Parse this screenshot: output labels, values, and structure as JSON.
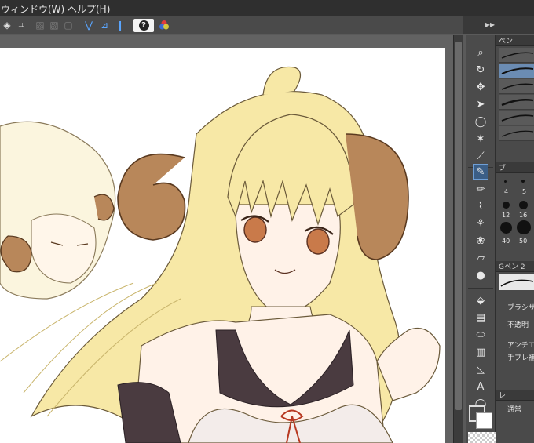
{
  "menu": {
    "window_label": "ウィンドウ(W)",
    "help_label": "ヘルプ(H)"
  },
  "toolbar": {
    "help_glyph": "?"
  },
  "dock": {
    "expand_glyph": "▸▸"
  },
  "panels": {
    "pen_tab": "ペン",
    "brush_size_tab": "ブ",
    "tool_property_tab": "Gペン 2",
    "brush_size_label": "ブラシサ",
    "opacity_label": "不透明",
    "antialias_label": "アンチエイ",
    "stabilization_label": "手ブレ補",
    "layer_tab": "レ",
    "blend_mode_label": "通常",
    "brush_sizes": [
      "4",
      "5",
      "12",
      "16",
      "40",
      "50"
    ]
  },
  "colors": {
    "main_color": "#4a4a4a",
    "sub_color": "#ffffff",
    "accent": "#3b5e86",
    "menu_bg": "#2f2f2f",
    "toolbar_bg": "#4a4a4a"
  },
  "tools": [
    "zoom-icon",
    "lasso-icon",
    "move-icon",
    "eyedropper-icon",
    "pen-icon",
    "pencil-icon",
    "brush-icon",
    "airbrush-icon",
    "eraser-icon",
    "fill-icon",
    "gradient-icon",
    "figure-icon",
    "ruler-icon",
    "text-icon",
    "balloon-icon",
    "correction-icon"
  ]
}
